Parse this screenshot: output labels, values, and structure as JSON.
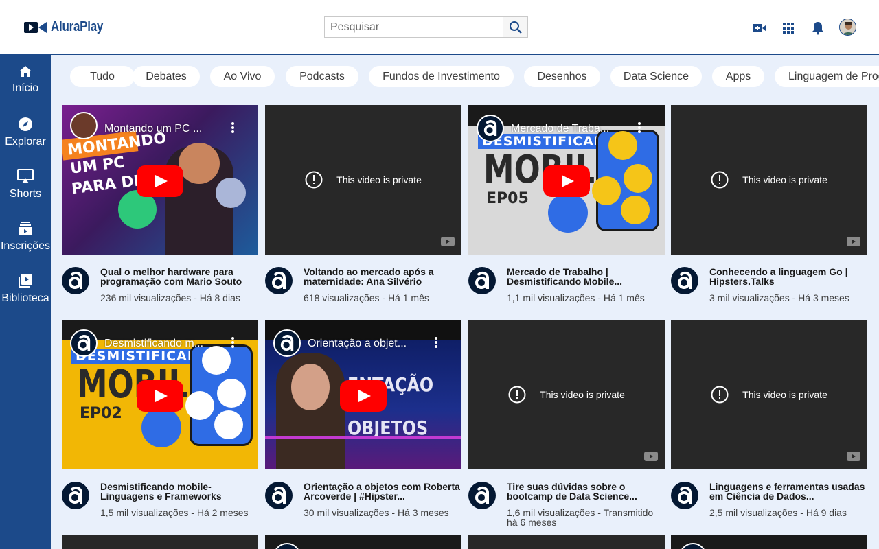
{
  "header": {
    "logo_text": "AluraPlay",
    "search_placeholder": "Pesquisar"
  },
  "sidebar": {
    "items": [
      {
        "label": "Início",
        "icon": "home-icon"
      },
      {
        "label": "Explorar",
        "icon": "compass-icon"
      },
      {
        "label": "Shorts",
        "icon": "shorts-icon"
      },
      {
        "label": "Inscrições",
        "icon": "subscriptions-icon"
      },
      {
        "label": "Biblioteca",
        "icon": "library-icon"
      }
    ]
  },
  "chips": [
    "Tudo",
    "Debates",
    "Ao Vivo",
    "Podcasts",
    "Fundos de Investimento",
    "Desenhos",
    "Data Science",
    "Apps",
    "Linguagem de Prog"
  ],
  "videos": [
    {
      "thumb_title": "Montando um PC ...",
      "title": "Qual o melhor hardware para programação com Mario Souto",
      "info": "236 mil visualizações - Há 8 dias",
      "private": false,
      "theme": "pc"
    },
    {
      "private_text": "This video is private",
      "title": "Voltando ao mercado após a maternidade: Ana Silvério",
      "info": "618 visualizações - Há 1 mês",
      "private": true
    },
    {
      "thumb_title": "Mercado de Traba...",
      "title": "Mercado de Trabalho | Desmistificando Mobile...",
      "info": "1,1 mil visualizações - Há 1 mês",
      "private": false,
      "theme": "mobile-gray",
      "thumb_big": "MOBILE",
      "thumb_banner": "DESMISTIFICANDO",
      "thumb_ep": "EP05"
    },
    {
      "private_text": "This video is private",
      "title": "Conhecendo a linguagem Go | Hipsters.Talks",
      "info": "3 mil visualizações - Há 3 meses",
      "private": true
    },
    {
      "thumb_title": "Desmistificando m...",
      "title": "Desmistificando mobile- Linguagens e Frameworks",
      "info": "1,5 mil visualizações - Há 2 meses",
      "private": false,
      "theme": "mobile-yellow",
      "thumb_big": "MOBILE",
      "thumb_banner": "DESMISTIFICANDO",
      "thumb_ep": "EP02"
    },
    {
      "thumb_title": "Orientação a objet...",
      "title": "Orientação a objetos com Roberta Arcoverde | #Hipster...",
      "info": "30 mil visualizações - Há 3 meses",
      "private": false,
      "theme": "oo",
      "thumb_big": "ENTAÇÃO",
      "thumb_big2": "A OBJETOS"
    },
    {
      "private_text": "This video is private",
      "title": "Tire suas dúvidas sobre o bootcamp de Data Science...",
      "info": "1,6 mil visualizações - Transmitido há 6 meses",
      "private": true
    },
    {
      "private_text": "This video is private",
      "title": "Linguagens e ferramentas usadas em Ciência de Dados...",
      "info": "2,5 mil visualizações - Há 9 dias",
      "private": true
    }
  ],
  "colors": {
    "brand": "#1c4a8a",
    "background": "#e9f0fb",
    "dark": "#041833",
    "play_red": "#ff0000"
  }
}
